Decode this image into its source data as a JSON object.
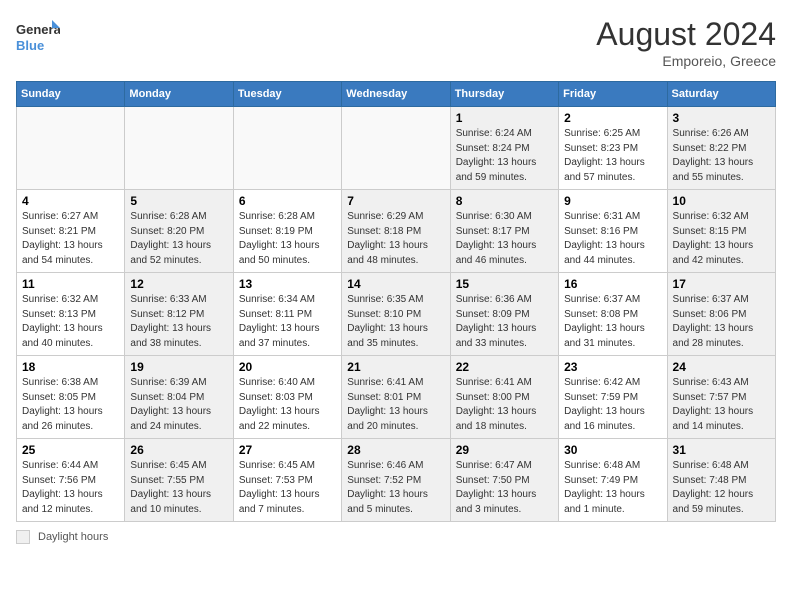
{
  "header": {
    "logo_line1": "General",
    "logo_line2": "Blue",
    "month_year": "August 2024",
    "location": "Emporeio, Greece"
  },
  "footer": {
    "label": "Daylight hours"
  },
  "days_of_week": [
    "Sunday",
    "Monday",
    "Tuesday",
    "Wednesday",
    "Thursday",
    "Friday",
    "Saturday"
  ],
  "weeks": [
    [
      {
        "num": "",
        "info": "",
        "empty": true
      },
      {
        "num": "",
        "info": "",
        "empty": true
      },
      {
        "num": "",
        "info": "",
        "empty": true
      },
      {
        "num": "",
        "info": "",
        "empty": true
      },
      {
        "num": "1",
        "info": "Sunrise: 6:24 AM\nSunset: 8:24 PM\nDaylight: 13 hours\nand 59 minutes.",
        "shaded": true
      },
      {
        "num": "2",
        "info": "Sunrise: 6:25 AM\nSunset: 8:23 PM\nDaylight: 13 hours\nand 57 minutes."
      },
      {
        "num": "3",
        "info": "Sunrise: 6:26 AM\nSunset: 8:22 PM\nDaylight: 13 hours\nand 55 minutes.",
        "shaded": true
      }
    ],
    [
      {
        "num": "4",
        "info": "Sunrise: 6:27 AM\nSunset: 8:21 PM\nDaylight: 13 hours\nand 54 minutes."
      },
      {
        "num": "5",
        "info": "Sunrise: 6:28 AM\nSunset: 8:20 PM\nDaylight: 13 hours\nand 52 minutes.",
        "shaded": true
      },
      {
        "num": "6",
        "info": "Sunrise: 6:28 AM\nSunset: 8:19 PM\nDaylight: 13 hours\nand 50 minutes."
      },
      {
        "num": "7",
        "info": "Sunrise: 6:29 AM\nSunset: 8:18 PM\nDaylight: 13 hours\nand 48 minutes.",
        "shaded": true
      },
      {
        "num": "8",
        "info": "Sunrise: 6:30 AM\nSunset: 8:17 PM\nDaylight: 13 hours\nand 46 minutes.",
        "shaded": true
      },
      {
        "num": "9",
        "info": "Sunrise: 6:31 AM\nSunset: 8:16 PM\nDaylight: 13 hours\nand 44 minutes."
      },
      {
        "num": "10",
        "info": "Sunrise: 6:32 AM\nSunset: 8:15 PM\nDaylight: 13 hours\nand 42 minutes.",
        "shaded": true
      }
    ],
    [
      {
        "num": "11",
        "info": "Sunrise: 6:32 AM\nSunset: 8:13 PM\nDaylight: 13 hours\nand 40 minutes."
      },
      {
        "num": "12",
        "info": "Sunrise: 6:33 AM\nSunset: 8:12 PM\nDaylight: 13 hours\nand 38 minutes.",
        "shaded": true
      },
      {
        "num": "13",
        "info": "Sunrise: 6:34 AM\nSunset: 8:11 PM\nDaylight: 13 hours\nand 37 minutes."
      },
      {
        "num": "14",
        "info": "Sunrise: 6:35 AM\nSunset: 8:10 PM\nDaylight: 13 hours\nand 35 minutes.",
        "shaded": true
      },
      {
        "num": "15",
        "info": "Sunrise: 6:36 AM\nSunset: 8:09 PM\nDaylight: 13 hours\nand 33 minutes.",
        "shaded": true
      },
      {
        "num": "16",
        "info": "Sunrise: 6:37 AM\nSunset: 8:08 PM\nDaylight: 13 hours\nand 31 minutes."
      },
      {
        "num": "17",
        "info": "Sunrise: 6:37 AM\nSunset: 8:06 PM\nDaylight: 13 hours\nand 28 minutes.",
        "shaded": true
      }
    ],
    [
      {
        "num": "18",
        "info": "Sunrise: 6:38 AM\nSunset: 8:05 PM\nDaylight: 13 hours\nand 26 minutes."
      },
      {
        "num": "19",
        "info": "Sunrise: 6:39 AM\nSunset: 8:04 PM\nDaylight: 13 hours\nand 24 minutes.",
        "shaded": true
      },
      {
        "num": "20",
        "info": "Sunrise: 6:40 AM\nSunset: 8:03 PM\nDaylight: 13 hours\nand 22 minutes."
      },
      {
        "num": "21",
        "info": "Sunrise: 6:41 AM\nSunset: 8:01 PM\nDaylight: 13 hours\nand 20 minutes.",
        "shaded": true
      },
      {
        "num": "22",
        "info": "Sunrise: 6:41 AM\nSunset: 8:00 PM\nDaylight: 13 hours\nand 18 minutes.",
        "shaded": true
      },
      {
        "num": "23",
        "info": "Sunrise: 6:42 AM\nSunset: 7:59 PM\nDaylight: 13 hours\nand 16 minutes."
      },
      {
        "num": "24",
        "info": "Sunrise: 6:43 AM\nSunset: 7:57 PM\nDaylight: 13 hours\nand 14 minutes.",
        "shaded": true
      }
    ],
    [
      {
        "num": "25",
        "info": "Sunrise: 6:44 AM\nSunset: 7:56 PM\nDaylight: 13 hours\nand 12 minutes."
      },
      {
        "num": "26",
        "info": "Sunrise: 6:45 AM\nSunset: 7:55 PM\nDaylight: 13 hours\nand 10 minutes.",
        "shaded": true
      },
      {
        "num": "27",
        "info": "Sunrise: 6:45 AM\nSunset: 7:53 PM\nDaylight: 13 hours\nand 7 minutes."
      },
      {
        "num": "28",
        "info": "Sunrise: 6:46 AM\nSunset: 7:52 PM\nDaylight: 13 hours\nand 5 minutes.",
        "shaded": true
      },
      {
        "num": "29",
        "info": "Sunrise: 6:47 AM\nSunset: 7:50 PM\nDaylight: 13 hours\nand 3 minutes.",
        "shaded": true
      },
      {
        "num": "30",
        "info": "Sunrise: 6:48 AM\nSunset: 7:49 PM\nDaylight: 13 hours\nand 1 minute."
      },
      {
        "num": "31",
        "info": "Sunrise: 6:48 AM\nSunset: 7:48 PM\nDaylight: 12 hours\nand 59 minutes.",
        "shaded": true
      }
    ]
  ]
}
